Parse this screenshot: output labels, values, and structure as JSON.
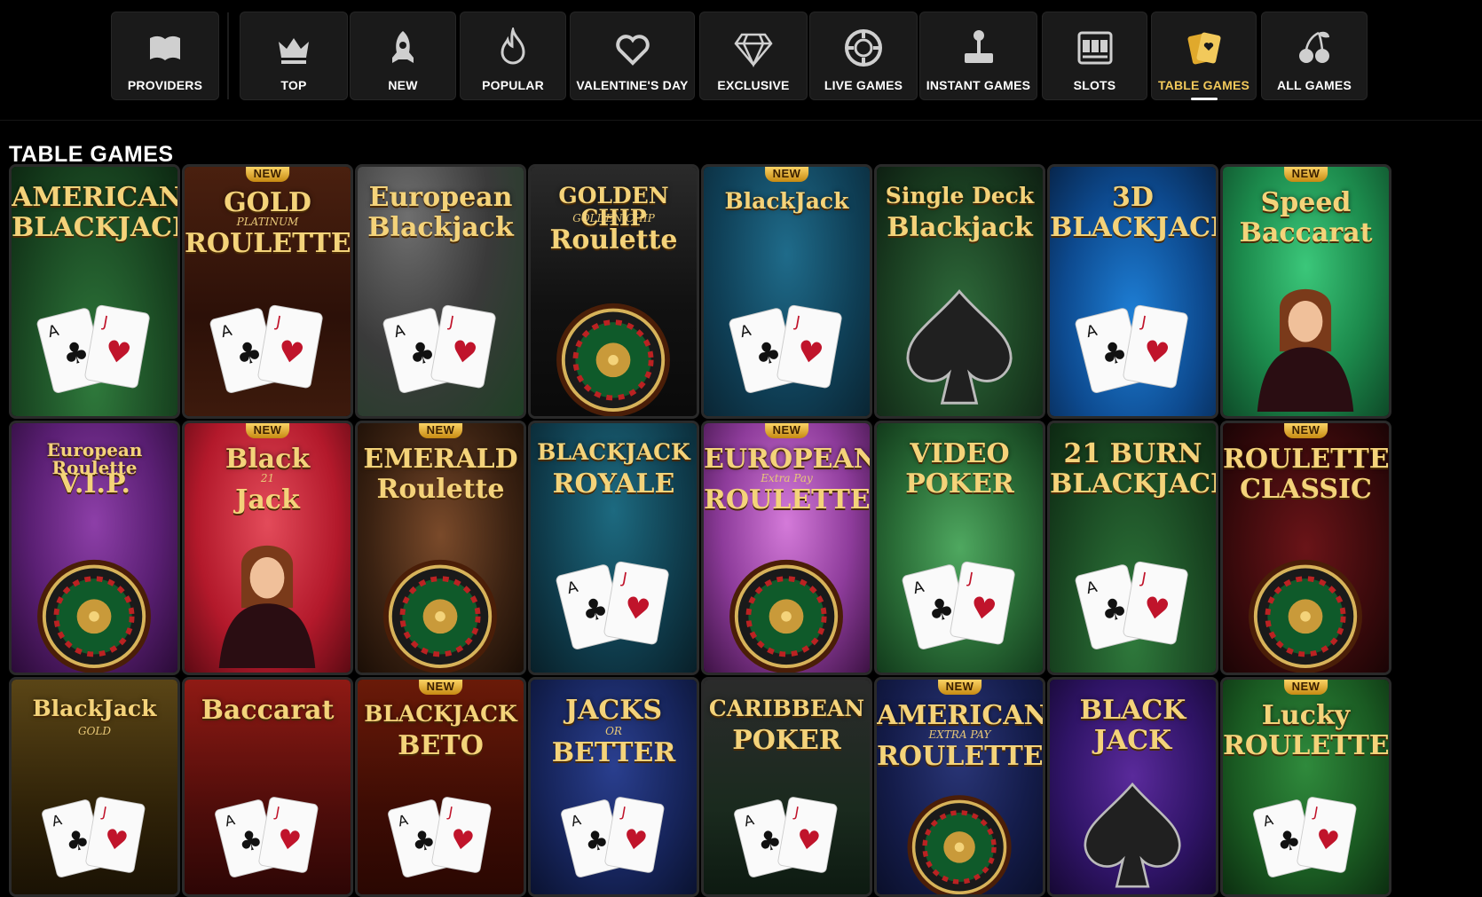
{
  "nav": {
    "items": [
      {
        "label": "PROVIDERS",
        "icon": "book-icon"
      },
      {
        "label": "TOP",
        "icon": "crown-icon"
      },
      {
        "label": "NEW",
        "icon": "rocket-icon"
      },
      {
        "label": "POPULAR",
        "icon": "flame-icon"
      },
      {
        "label": "VALENTINE'S DAY",
        "icon": "heart-icon"
      },
      {
        "label": "EXCLUSIVE",
        "icon": "diamond-icon"
      },
      {
        "label": "LIVE GAMES",
        "icon": "chip-icon"
      },
      {
        "label": "INSTANT GAMES",
        "icon": "joystick-icon"
      },
      {
        "label": "SLOTS",
        "icon": "slot-machine-icon"
      },
      {
        "label": "TABLE GAMES",
        "icon": "cards-icon",
        "active": true
      },
      {
        "label": "ALL GAMES",
        "icon": "cherries-icon"
      }
    ]
  },
  "section": {
    "title": "TABLE GAMES"
  },
  "badge_label": "NEW",
  "colors": {
    "accent": "#f2c95b",
    "background": "#000000",
    "button": "#1a1a1a"
  },
  "games": [
    {
      "l1": "AMERICAN",
      "l2": "BLACKJACK",
      "sub": "",
      "new": false,
      "theme": "green-felt"
    },
    {
      "l1": "GOLD",
      "l2": "ROULETTE",
      "sub": "PLATINUM",
      "new": true,
      "theme": "wood"
    },
    {
      "l1": "European",
      "l2": "Blackjack",
      "sub": "",
      "new": false,
      "theme": "grey-cards"
    },
    {
      "l1": "GOLDEN CHIP",
      "l2": "Roulette",
      "sub": "GOLDEN CHIP",
      "new": false,
      "theme": "dark-wheel"
    },
    {
      "l1": "BlackJack",
      "l2": "",
      "sub": "",
      "new": true,
      "theme": "teal-cards"
    },
    {
      "l1": "Single Deck",
      "l2": "Blackjack",
      "sub": "",
      "new": false,
      "theme": "spade"
    },
    {
      "l1": "3D",
      "l2": "BLACKJACK",
      "sub": "",
      "new": false,
      "theme": "blue-red"
    },
    {
      "l1": "Speed",
      "l2": "Baccarat",
      "sub": "",
      "new": true,
      "theme": "green-dealer"
    },
    {
      "l1": "European Roulette",
      "l2": "V.I.P.",
      "sub": "",
      "new": false,
      "theme": "purple-wheel"
    },
    {
      "l1": "Black",
      "l2": "Jack",
      "sub": "21",
      "new": true,
      "theme": "red-dealer"
    },
    {
      "l1": "EMERALD",
      "l2": "Roulette",
      "sub": "",
      "new": true,
      "theme": "emerald"
    },
    {
      "l1": "BLACKJACK",
      "l2": "ROYALE",
      "sub": "",
      "new": false,
      "theme": "teal-royale"
    },
    {
      "l1": "EUROPEAN",
      "l2": "ROULETTE",
      "sub": "Extra Pay",
      "new": true,
      "theme": "pink-wheel"
    },
    {
      "l1": "VIDEO",
      "l2": "POKER",
      "sub": "",
      "new": false,
      "theme": "green-poker"
    },
    {
      "l1": "21 BURN",
      "l2": "BLACKJACK",
      "sub": "",
      "new": false,
      "theme": "green-felt"
    },
    {
      "l1": "ROULETTE",
      "l2": "CLASSIC",
      "sub": "",
      "new": true,
      "theme": "maroon-wheel"
    },
    {
      "l1": "BlackJack",
      "l2": "",
      "sub": "GOLD",
      "new": false,
      "theme": "gold-chips"
    },
    {
      "l1": "Baccarat",
      "l2": "",
      "sub": "",
      "new": false,
      "theme": "red-baccarat"
    },
    {
      "l1": "BLACKJACK",
      "l2": "BETO",
      "sub": "",
      "new": true,
      "theme": "beto"
    },
    {
      "l1": "JACKS",
      "l2": "BETTER",
      "sub": "OR",
      "new": false,
      "theme": "navy-jacks"
    },
    {
      "l1": "CARIBBEAN",
      "l2": "POKER",
      "sub": "",
      "new": false,
      "theme": "dark-green-poker"
    },
    {
      "l1": "AMERICAN",
      "l2": "ROULETTE",
      "sub": "EXTRA PAY",
      "new": true,
      "theme": "navy-roulette"
    },
    {
      "l1": "BLACK",
      "l2": "JACK",
      "sub": "",
      "new": false,
      "theme": "purple-spade"
    },
    {
      "l1": "Lucky",
      "l2": "ROULETTE",
      "sub": "",
      "new": true,
      "theme": "lucky-green"
    }
  ]
}
